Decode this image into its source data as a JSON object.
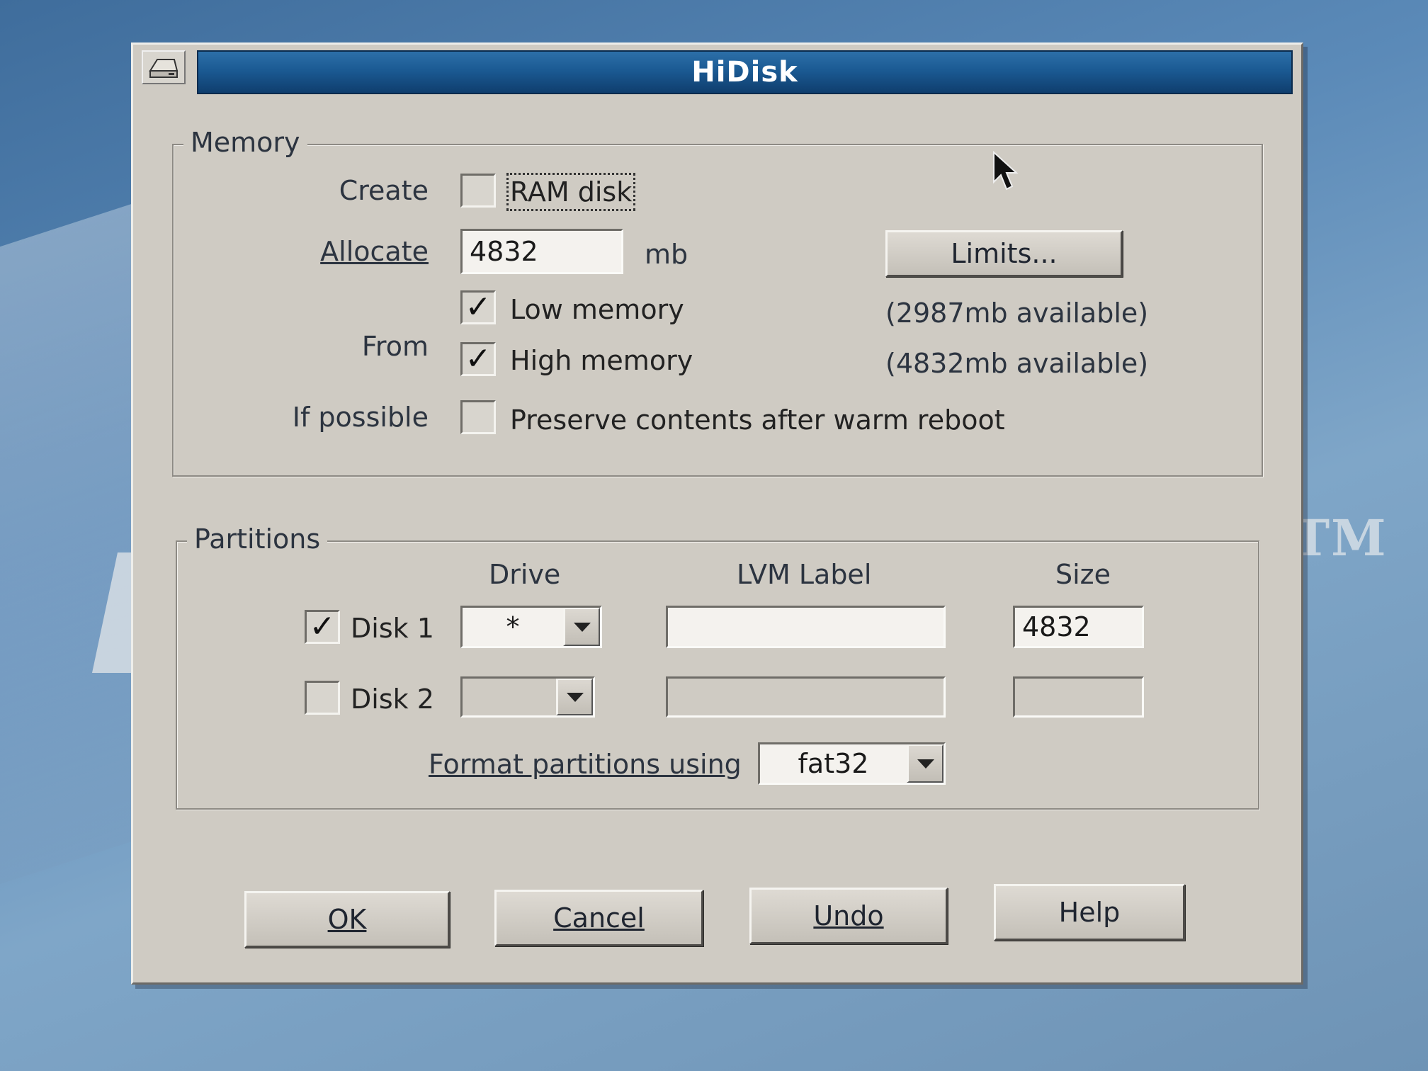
{
  "window": {
    "title": "HiDisk"
  },
  "memory": {
    "legend": "Memory",
    "create_label": "Create",
    "ram_disk": {
      "label": "RAM disk",
      "checked": false
    },
    "allocate_label": "Allocate",
    "allocate_value": "4832",
    "allocate_unit": "mb",
    "limits_button": "Limits...",
    "from_label": "From",
    "low_memory": {
      "label": "Low memory",
      "checked": true,
      "available": "(2987mb available)"
    },
    "high_memory": {
      "label": "High memory",
      "checked": true,
      "available": "(4832mb available)"
    },
    "if_possible_label": "If possible",
    "preserve": {
      "label": "Preserve contents after warm reboot",
      "checked": false
    }
  },
  "partitions": {
    "legend": "Partitions",
    "columns": {
      "drive": "Drive",
      "lvm_label": "LVM Label",
      "size": "Size"
    },
    "disks": [
      {
        "label": "Disk 1",
        "checked": true,
        "drive": "*",
        "lvm_label": "",
        "size": "4832"
      },
      {
        "label": "Disk 2",
        "checked": false,
        "drive": "",
        "lvm_label": "",
        "size": ""
      }
    ],
    "format_label": "Format partitions using",
    "format_value": "fat32"
  },
  "buttons": {
    "ok": "OK",
    "cancel": "Cancel",
    "undo": "Undo",
    "help": "Help"
  },
  "icons": [
    "disk-drive-icon",
    "mouse-cursor-icon",
    "chevron-down-icon",
    "checkmark-icon"
  ],
  "colors": {
    "title_bar": "#1b5a93",
    "dialog_bg": "#cfcbc3",
    "desktop": "#5b8ab8"
  }
}
